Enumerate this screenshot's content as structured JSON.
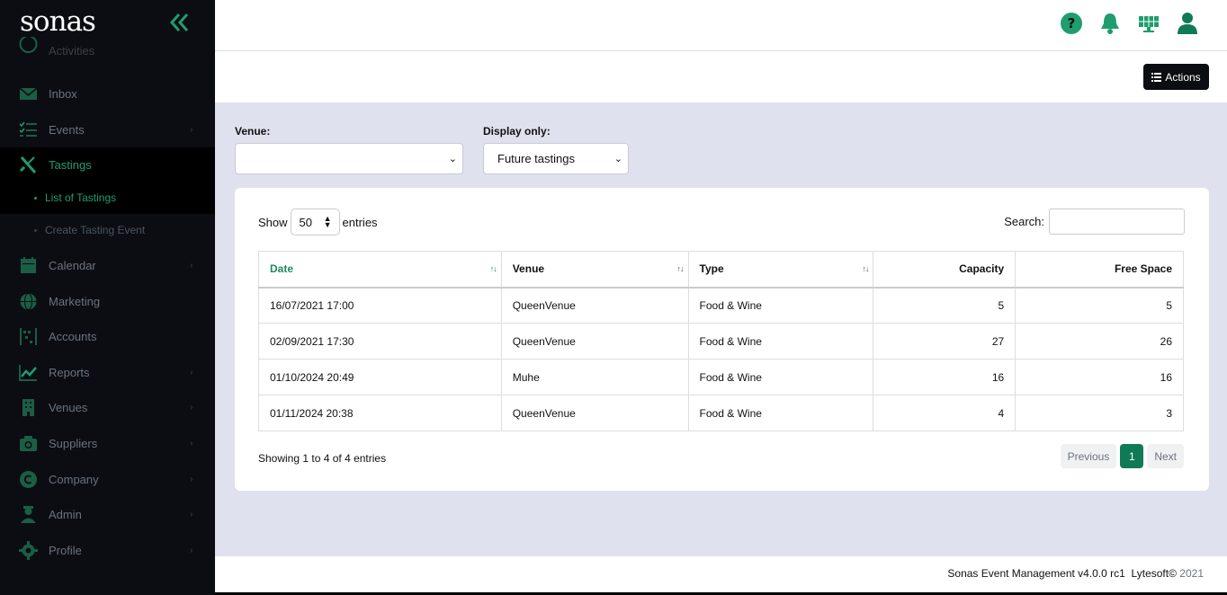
{
  "brand": {
    "logo_text": "sonas"
  },
  "sidebar": {
    "partial_item": "Activities",
    "items": [
      {
        "label": "Inbox",
        "icon": "mail-icon",
        "chevron": false
      },
      {
        "label": "Events",
        "icon": "list-check-icon",
        "chevron": true
      },
      {
        "label": "Tastings",
        "icon": "utensils-icon",
        "chevron": false,
        "active": true
      },
      {
        "label": "Calendar",
        "icon": "calendar-icon",
        "chevron": true
      },
      {
        "label": "Marketing",
        "icon": "globe-icon",
        "chevron": false
      },
      {
        "label": "Accounts",
        "icon": "abacus-icon",
        "chevron": false
      },
      {
        "label": "Reports",
        "icon": "chart-line-icon",
        "chevron": true
      },
      {
        "label": "Venues",
        "icon": "building-icon",
        "chevron": true
      },
      {
        "label": "Suppliers",
        "icon": "camera-icon",
        "chevron": true
      },
      {
        "label": "Company",
        "icon": "copyright-icon",
        "chevron": true
      },
      {
        "label": "Admin",
        "icon": "user-tie-icon",
        "chevron": true
      },
      {
        "label": "Profile",
        "icon": "gear-icon",
        "chevron": true
      }
    ],
    "sub_items": [
      {
        "label": "List of Tastings",
        "active": true
      },
      {
        "label": "Create Tasting Event",
        "active": false
      }
    ]
  },
  "header": {
    "icons": [
      "help-icon",
      "bell-icon",
      "solar-panel-icon",
      "user-icon"
    ],
    "actions_label": "Actions"
  },
  "filters": {
    "venue_label": "Venue:",
    "venue_value": "",
    "display_label": "Display only:",
    "display_value": "Future tastings"
  },
  "table_controls": {
    "show_label": "Show",
    "entries_value": "50",
    "entries_label": "entries",
    "search_label": "Search:"
  },
  "table": {
    "columns": [
      "Date",
      "Venue",
      "Type",
      "Capacity",
      "Free Space"
    ],
    "rows": [
      [
        "16/07/2021 17:00",
        "QueenVenue",
        "Food & Wine",
        "5",
        "5"
      ],
      [
        "02/09/2021 17:30",
        "QueenVenue",
        "Food & Wine",
        "27",
        "26"
      ],
      [
        "01/10/2024 20:49",
        "Muhe",
        "Food & Wine",
        "16",
        "16"
      ],
      [
        "01/11/2024 20:38",
        "QueenVenue",
        "Food & Wine",
        "4",
        "3"
      ]
    ]
  },
  "pagination": {
    "info": "Showing 1 to 4 of 4 entries",
    "previous": "Previous",
    "current": "1",
    "next": "Next"
  },
  "footer": {
    "text": "Sonas Event Management v4.0.0 rc1  Lytesoft©",
    "year": "2021"
  },
  "colors": {
    "accent": "#1f9d6e",
    "sidebar_bg": "#0b0d12",
    "content_bg": "#dfe1ee"
  }
}
